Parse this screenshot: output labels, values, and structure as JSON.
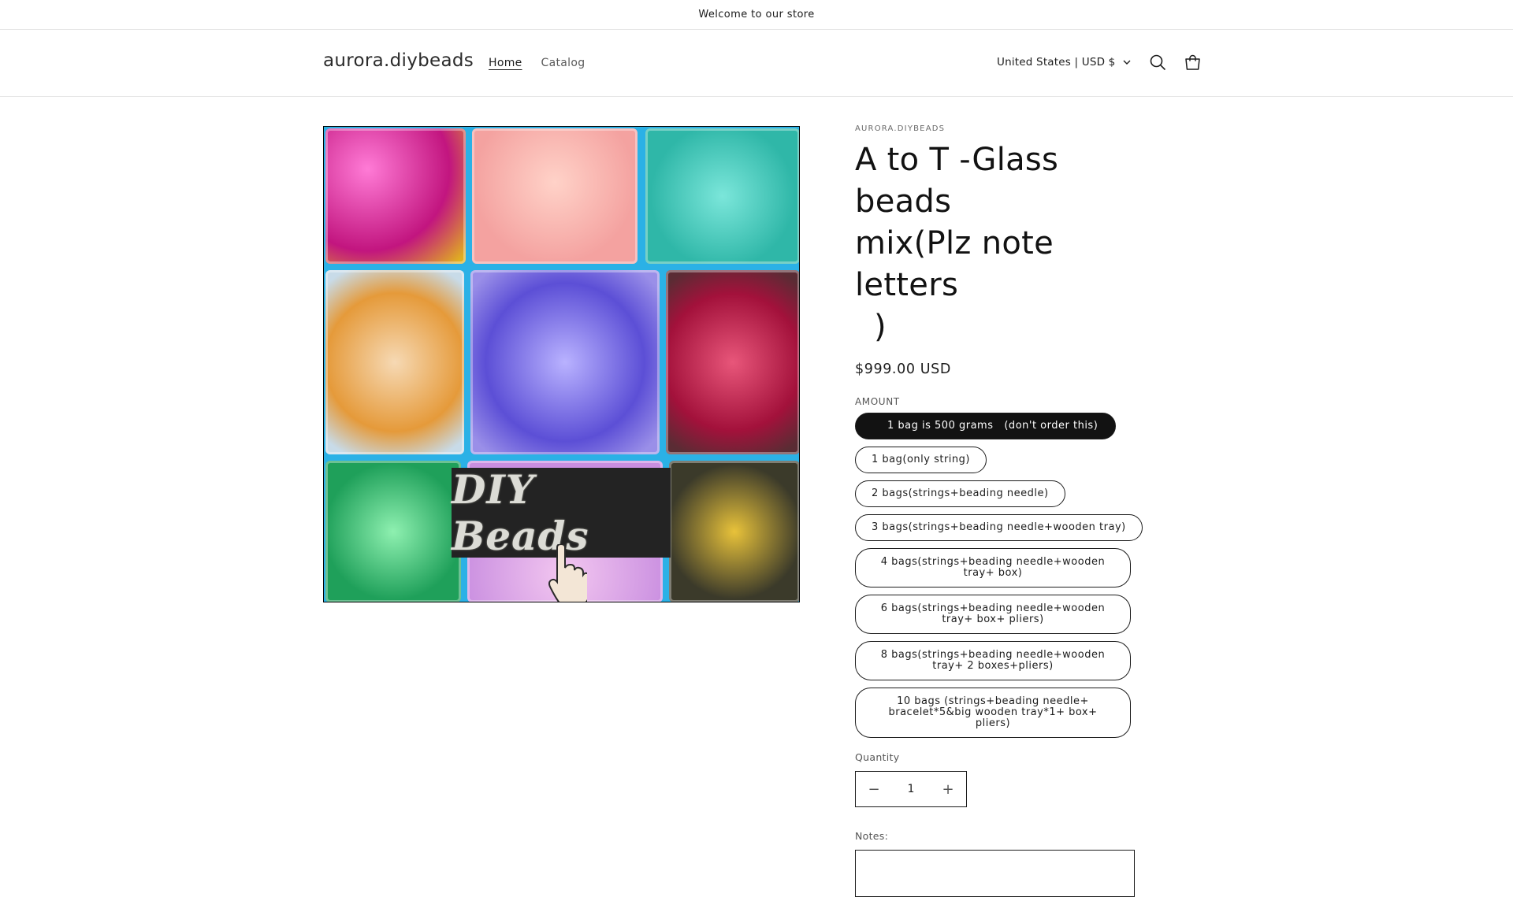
{
  "announcement": {
    "text": "Welcome to our store"
  },
  "header": {
    "logo": "aurora.diybeads",
    "nav": [
      {
        "label": "Home"
      },
      {
        "label": "Catalog"
      }
    ],
    "currency": "United States | USD $",
    "icons": {
      "search": "search-icon",
      "cart": "cart-icon",
      "chevron": "chevron-down-icon"
    }
  },
  "media": {
    "overlay_text": "DIY Beads",
    "icon": "pointer-hand-icon"
  },
  "product": {
    "vendor": "AURORA.DIYBEADS",
    "title_line1": "A to T -Glass beads",
    "title_line2": "mix(Plz note letters",
    "title_line3": ")",
    "price": "$999.00 USD",
    "option_label": "AMOUNT",
    "variants": [
      {
        "label": "1 bag is 500 grams   (don't order this)",
        "selected": true
      },
      {
        "label": "1 bag(only string)"
      },
      {
        "label": "2 bags(strings+beading needle)"
      },
      {
        "label": "3 bags(strings+beading needle+wooden tray)"
      },
      {
        "label": "4 bags(strings+beading needle+wooden tray+ box)"
      },
      {
        "label": "6 bags(strings+beading needle+wooden tray+ box+ pliers)"
      },
      {
        "label": "8 bags(strings+beading needle+wooden tray+ 2 boxes+pliers)"
      },
      {
        "label": "10 bags (strings+beading needle+ bracelet*5&big wooden tray*1+ box+ pliers)"
      }
    ],
    "quantity_label": "Quantity",
    "quantity_value": "1",
    "quantity_minus": "−",
    "quantity_plus": "+",
    "notes_label": "Notes:"
  },
  "colors": {
    "selected_bg": "#121212",
    "border": "#1c1c1c",
    "image_bg": "#2bb1e6"
  }
}
